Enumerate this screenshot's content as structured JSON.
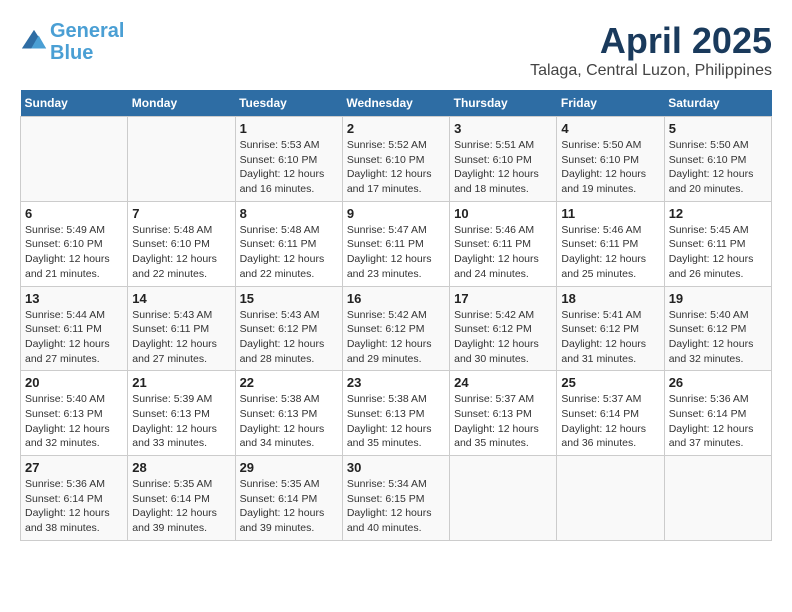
{
  "header": {
    "logo_line1": "General",
    "logo_line2": "Blue",
    "title": "April 2025",
    "subtitle": "Talaga, Central Luzon, Philippines"
  },
  "calendar": {
    "weekdays": [
      "Sunday",
      "Monday",
      "Tuesday",
      "Wednesday",
      "Thursday",
      "Friday",
      "Saturday"
    ],
    "weeks": [
      [
        {
          "day": "",
          "sunrise": "",
          "sunset": "",
          "daylight": ""
        },
        {
          "day": "",
          "sunrise": "",
          "sunset": "",
          "daylight": ""
        },
        {
          "day": "1",
          "sunrise": "Sunrise: 5:53 AM",
          "sunset": "Sunset: 6:10 PM",
          "daylight": "Daylight: 12 hours and 16 minutes."
        },
        {
          "day": "2",
          "sunrise": "Sunrise: 5:52 AM",
          "sunset": "Sunset: 6:10 PM",
          "daylight": "Daylight: 12 hours and 17 minutes."
        },
        {
          "day": "3",
          "sunrise": "Sunrise: 5:51 AM",
          "sunset": "Sunset: 6:10 PM",
          "daylight": "Daylight: 12 hours and 18 minutes."
        },
        {
          "day": "4",
          "sunrise": "Sunrise: 5:50 AM",
          "sunset": "Sunset: 6:10 PM",
          "daylight": "Daylight: 12 hours and 19 minutes."
        },
        {
          "day": "5",
          "sunrise": "Sunrise: 5:50 AM",
          "sunset": "Sunset: 6:10 PM",
          "daylight": "Daylight: 12 hours and 20 minutes."
        }
      ],
      [
        {
          "day": "6",
          "sunrise": "Sunrise: 5:49 AM",
          "sunset": "Sunset: 6:10 PM",
          "daylight": "Daylight: 12 hours and 21 minutes."
        },
        {
          "day": "7",
          "sunrise": "Sunrise: 5:48 AM",
          "sunset": "Sunset: 6:10 PM",
          "daylight": "Daylight: 12 hours and 22 minutes."
        },
        {
          "day": "8",
          "sunrise": "Sunrise: 5:48 AM",
          "sunset": "Sunset: 6:11 PM",
          "daylight": "Daylight: 12 hours and 22 minutes."
        },
        {
          "day": "9",
          "sunrise": "Sunrise: 5:47 AM",
          "sunset": "Sunset: 6:11 PM",
          "daylight": "Daylight: 12 hours and 23 minutes."
        },
        {
          "day": "10",
          "sunrise": "Sunrise: 5:46 AM",
          "sunset": "Sunset: 6:11 PM",
          "daylight": "Daylight: 12 hours and 24 minutes."
        },
        {
          "day": "11",
          "sunrise": "Sunrise: 5:46 AM",
          "sunset": "Sunset: 6:11 PM",
          "daylight": "Daylight: 12 hours and 25 minutes."
        },
        {
          "day": "12",
          "sunrise": "Sunrise: 5:45 AM",
          "sunset": "Sunset: 6:11 PM",
          "daylight": "Daylight: 12 hours and 26 minutes."
        }
      ],
      [
        {
          "day": "13",
          "sunrise": "Sunrise: 5:44 AM",
          "sunset": "Sunset: 6:11 PM",
          "daylight": "Daylight: 12 hours and 27 minutes."
        },
        {
          "day": "14",
          "sunrise": "Sunrise: 5:43 AM",
          "sunset": "Sunset: 6:11 PM",
          "daylight": "Daylight: 12 hours and 27 minutes."
        },
        {
          "day": "15",
          "sunrise": "Sunrise: 5:43 AM",
          "sunset": "Sunset: 6:12 PM",
          "daylight": "Daylight: 12 hours and 28 minutes."
        },
        {
          "day": "16",
          "sunrise": "Sunrise: 5:42 AM",
          "sunset": "Sunset: 6:12 PM",
          "daylight": "Daylight: 12 hours and 29 minutes."
        },
        {
          "day": "17",
          "sunrise": "Sunrise: 5:42 AM",
          "sunset": "Sunset: 6:12 PM",
          "daylight": "Daylight: 12 hours and 30 minutes."
        },
        {
          "day": "18",
          "sunrise": "Sunrise: 5:41 AM",
          "sunset": "Sunset: 6:12 PM",
          "daylight": "Daylight: 12 hours and 31 minutes."
        },
        {
          "day": "19",
          "sunrise": "Sunrise: 5:40 AM",
          "sunset": "Sunset: 6:12 PM",
          "daylight": "Daylight: 12 hours and 32 minutes."
        }
      ],
      [
        {
          "day": "20",
          "sunrise": "Sunrise: 5:40 AM",
          "sunset": "Sunset: 6:13 PM",
          "daylight": "Daylight: 12 hours and 32 minutes."
        },
        {
          "day": "21",
          "sunrise": "Sunrise: 5:39 AM",
          "sunset": "Sunset: 6:13 PM",
          "daylight": "Daylight: 12 hours and 33 minutes."
        },
        {
          "day": "22",
          "sunrise": "Sunrise: 5:38 AM",
          "sunset": "Sunset: 6:13 PM",
          "daylight": "Daylight: 12 hours and 34 minutes."
        },
        {
          "day": "23",
          "sunrise": "Sunrise: 5:38 AM",
          "sunset": "Sunset: 6:13 PM",
          "daylight": "Daylight: 12 hours and 35 minutes."
        },
        {
          "day": "24",
          "sunrise": "Sunrise: 5:37 AM",
          "sunset": "Sunset: 6:13 PM",
          "daylight": "Daylight: 12 hours and 35 minutes."
        },
        {
          "day": "25",
          "sunrise": "Sunrise: 5:37 AM",
          "sunset": "Sunset: 6:14 PM",
          "daylight": "Daylight: 12 hours and 36 minutes."
        },
        {
          "day": "26",
          "sunrise": "Sunrise: 5:36 AM",
          "sunset": "Sunset: 6:14 PM",
          "daylight": "Daylight: 12 hours and 37 minutes."
        }
      ],
      [
        {
          "day": "27",
          "sunrise": "Sunrise: 5:36 AM",
          "sunset": "Sunset: 6:14 PM",
          "daylight": "Daylight: 12 hours and 38 minutes."
        },
        {
          "day": "28",
          "sunrise": "Sunrise: 5:35 AM",
          "sunset": "Sunset: 6:14 PM",
          "daylight": "Daylight: 12 hours and 39 minutes."
        },
        {
          "day": "29",
          "sunrise": "Sunrise: 5:35 AM",
          "sunset": "Sunset: 6:14 PM",
          "daylight": "Daylight: 12 hours and 39 minutes."
        },
        {
          "day": "30",
          "sunrise": "Sunrise: 5:34 AM",
          "sunset": "Sunset: 6:15 PM",
          "daylight": "Daylight: 12 hours and 40 minutes."
        },
        {
          "day": "",
          "sunrise": "",
          "sunset": "",
          "daylight": ""
        },
        {
          "day": "",
          "sunrise": "",
          "sunset": "",
          "daylight": ""
        },
        {
          "day": "",
          "sunrise": "",
          "sunset": "",
          "daylight": ""
        }
      ]
    ]
  }
}
